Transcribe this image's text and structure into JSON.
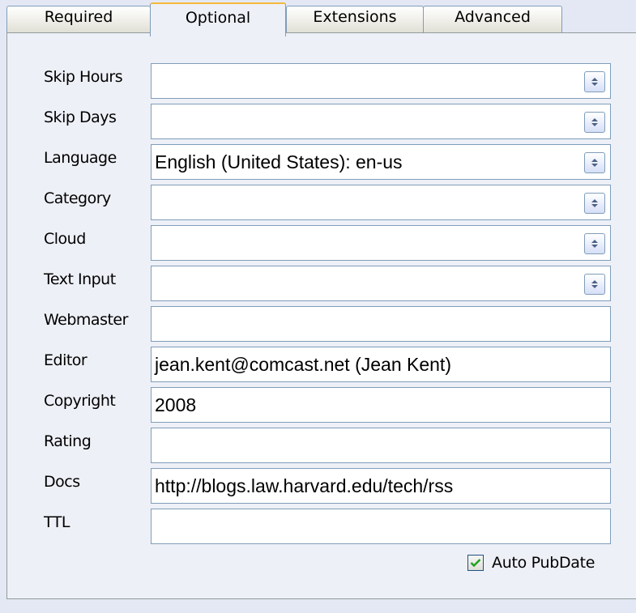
{
  "tabs": [
    {
      "label": "Required",
      "active": false
    },
    {
      "label": "Optional",
      "active": true
    },
    {
      "label": "Extensions",
      "active": false
    },
    {
      "label": "Advanced",
      "active": false
    }
  ],
  "fields": [
    {
      "label": "Skip Hours",
      "value": "",
      "type": "dropdown"
    },
    {
      "label": "Skip Days",
      "value": "",
      "type": "dropdown"
    },
    {
      "label": "Language",
      "value": "English (United States): en-us",
      "type": "dropdown"
    },
    {
      "label": "Category",
      "value": "",
      "type": "dropdown"
    },
    {
      "label": "Cloud",
      "value": "",
      "type": "dropdown"
    },
    {
      "label": "Text Input",
      "value": "",
      "type": "dropdown"
    },
    {
      "label": "Webmaster",
      "value": "",
      "type": "text"
    },
    {
      "label": "Editor",
      "value": "jean.kent@comcast.net (Jean Kent)",
      "type": "text"
    },
    {
      "label": "Copyright",
      "value": "2008",
      "type": "text"
    },
    {
      "label": "Rating",
      "value": "",
      "type": "text"
    },
    {
      "label": "Docs",
      "value": "http://blogs.law.harvard.edu/tech/rss",
      "type": "text"
    },
    {
      "label": "TTL",
      "value": "",
      "type": "text"
    }
  ],
  "auto_pubdate": {
    "label": "Auto PubDate",
    "checked": true
  },
  "colors": {
    "background": "#e4e8f5",
    "panel": "#eef0f7",
    "border": "#7f9db9",
    "active_tab_accent": "#f4b93a",
    "check": "#21a121"
  }
}
